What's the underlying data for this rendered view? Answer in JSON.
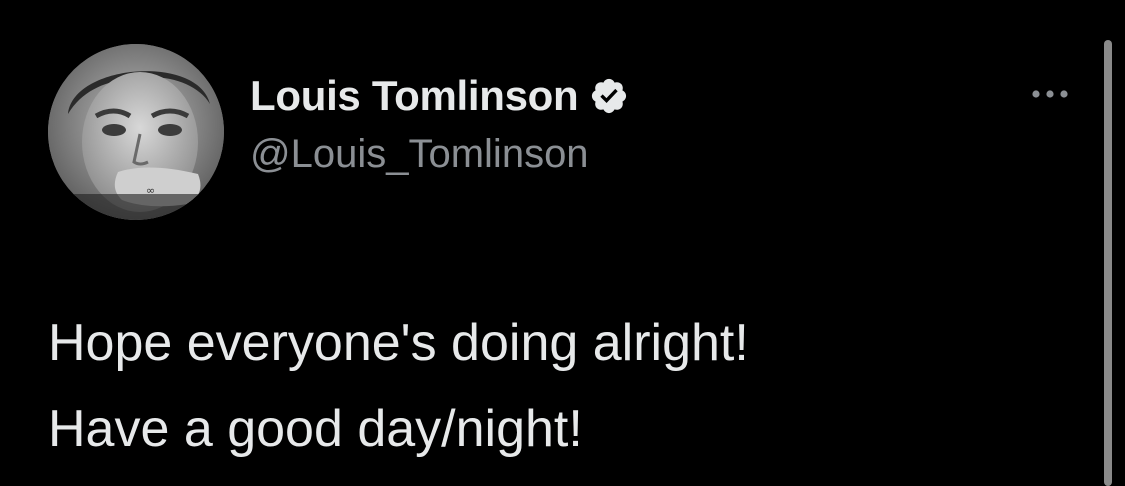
{
  "tweet": {
    "author": {
      "display_name": "Louis Tomlinson",
      "handle": "@Louis_Tomlinson",
      "verified": true,
      "avatar_icon": "profile-photo-avatar"
    },
    "text_lines": [
      "Hope everyone's doing alright!",
      "Have a good day/night!"
    ],
    "more_icon": "more-horizontal-icon"
  },
  "theme": {
    "background": "#000000",
    "primary_text": "#e7e9ea",
    "secondary_text": "#8b8f94",
    "verified_badge": "#e7e9ea"
  }
}
